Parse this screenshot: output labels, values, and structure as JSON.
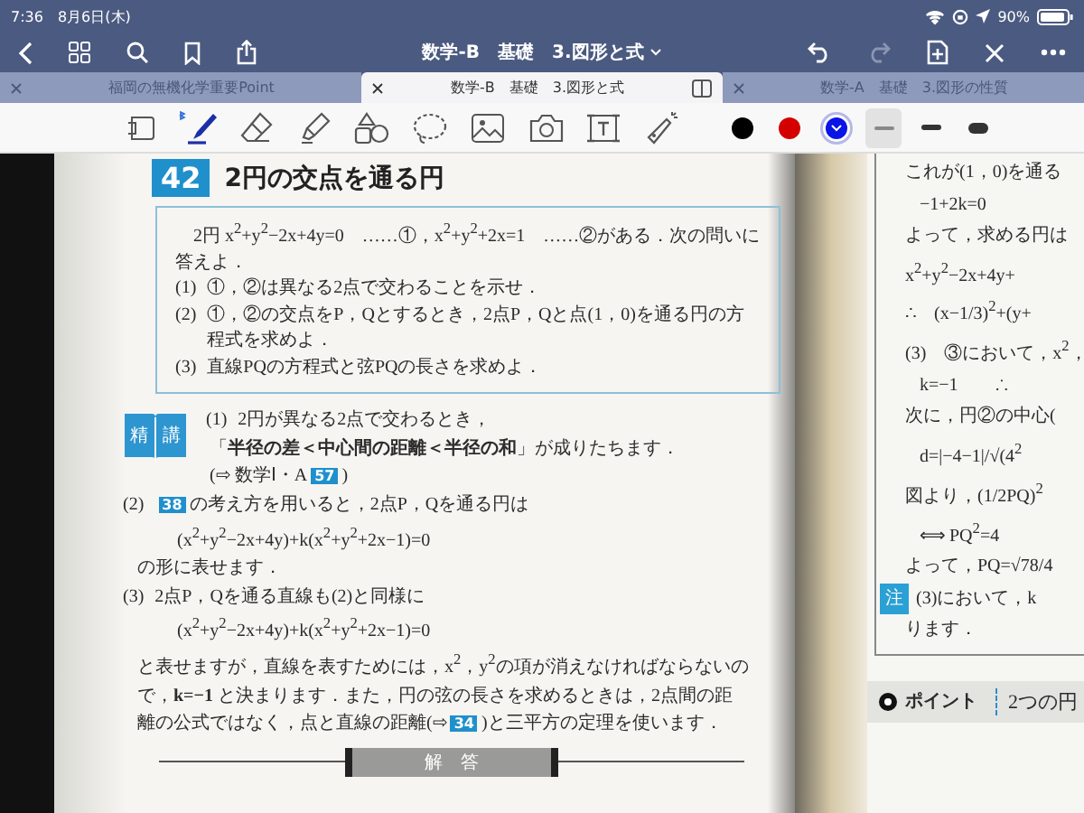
{
  "status_bar": {
    "time": "7:36",
    "date": "8月6日(木)",
    "battery": "90%"
  },
  "nav_bar": {
    "title": "数学-B　基礎　3.図形と式",
    "redo_disabled": true
  },
  "tabs": [
    {
      "label": "福岡の無機化学重要Point",
      "selected": false
    },
    {
      "label": "数学-B　基礎　3.図形と式",
      "selected": true
    },
    {
      "label": "数学-A　基礎　3.図形の性質",
      "selected": false
    }
  ],
  "toolbar": {
    "tools": [
      {
        "kind": "page",
        "selected": false
      },
      {
        "kind": "pen",
        "selected": true
      },
      {
        "kind": "eraser",
        "selected": false
      },
      {
        "kind": "highlighter",
        "selected": false
      },
      {
        "kind": "shapes",
        "selected": false
      },
      {
        "kind": "lasso",
        "selected": false
      },
      {
        "kind": "image",
        "selected": false
      },
      {
        "kind": "camera",
        "selected": false
      },
      {
        "kind": "text",
        "selected": false
      },
      {
        "kind": "laser",
        "selected": false
      }
    ],
    "colors": [
      {
        "color": "#000000",
        "selected": false
      },
      {
        "color": "#d40000",
        "selected": false
      },
      {
        "color": "#0a14e6",
        "selected": true
      }
    ],
    "widths": [
      {
        "kind": "thin",
        "selected": true
      },
      {
        "kind": "medium",
        "selected": false
      },
      {
        "kind": "thick",
        "selected": false
      }
    ]
  },
  "left_page": {
    "number": "42",
    "title": "2円の交点を通る円",
    "problem_intro": "2円 x$^{2}$+y$^{2}$−2x+4y=0　……①，x$^{2}$+y$^{2}$+2x=1　……②がある．次の問いに答えよ．",
    "problems": [
      {
        "label": "(1)",
        "text": "①，②は異なる2点で交わることを示せ．"
      },
      {
        "label": "(2)",
        "text": "①，②の交点をP，Qとするとき，2点P，Qと点(1，0)を通る円の方程式を求めよ．"
      },
      {
        "label": "(3)",
        "text": "直線PQの方程式と弦PQの長さを求めよ．"
      }
    ],
    "seiko": [
      "精",
      "講"
    ],
    "intro": [
      {
        "kind": "item",
        "label": "(1)",
        "parts": [
          {
            "kind": "text",
            "text": "2円が異なる2点で交わるとき，"
          }
        ]
      },
      {
        "kind": "cont",
        "parts": [
          {
            "kind": "text",
            "text": "「**半径の差＜中心間の距離＜半径の和**」が成りたちます．"
          }
        ]
      },
      {
        "kind": "cont",
        "parts": [
          {
            "kind": "text",
            "text": "(⇨ 数学Ⅰ・A"
          },
          {
            "kind": "ref",
            "text": "57"
          },
          {
            "kind": "text",
            "text": ")"
          }
        ]
      }
    ],
    "body": [
      {
        "kind": "item",
        "label": "(2)",
        "parts": [
          {
            "kind": "ref",
            "text": "38"
          },
          {
            "kind": "text",
            "text": "の考え方を用いると，2点P，Qを通る円は"
          }
        ]
      },
      {
        "kind": "formula",
        "parts": [
          {
            "kind": "text",
            "text": "(x$^{2}$+y$^{2}$−2x+4y)+k(x$^{2}$+y$^{2}$+2x−1)=0"
          }
        ]
      },
      {
        "kind": "para",
        "parts": [
          {
            "kind": "text",
            "text": "の形に表せます．"
          }
        ]
      },
      {
        "kind": "item",
        "label": "(3)",
        "parts": [
          {
            "kind": "text",
            "text": "2点P，Qを通る直線も(2)と同様に"
          }
        ]
      },
      {
        "kind": "formula",
        "parts": [
          {
            "kind": "text",
            "text": "(x$^{2}$+y$^{2}$−2x+4y)+k(x$^{2}$+y$^{2}$+2x−1)=0"
          }
        ]
      },
      {
        "kind": "para",
        "parts": [
          {
            "kind": "text",
            "text": "と表せますが，直線を表すためには，x$^{2}$，y$^{2}$の項が消えなければならないの"
          }
        ]
      },
      {
        "kind": "para",
        "parts": [
          {
            "kind": "text",
            "text": "で，**k=−1** と決まります．また，円の弦の長さを求めるときは，2点間の距"
          }
        ]
      },
      {
        "kind": "para",
        "parts": [
          {
            "kind": "text",
            "text": "離の公式ではなく，点と直線の距離(⇨"
          },
          {
            "kind": "ref",
            "text": "34"
          },
          {
            "kind": "text",
            "text": ")と三平方の定理を使います．"
          }
        ]
      }
    ],
    "answer_heading": "解　答"
  },
  "right_page": {
    "lines": [
      {
        "kind": "text",
        "text": "これが(1，0)を通る"
      },
      {
        "kind": "indent",
        "text": "−1+2k=0"
      },
      {
        "kind": "text",
        "text": "よって，求める円は"
      },
      {
        "kind": "text",
        "text": "x$^{2}$+y$^{2}$−2x+4y+"
      },
      {
        "kind": "text",
        "text": "∴　(x−1/3)$^{2}$+(y+"
      },
      {
        "kind": "text",
        "text": "(3)　③において，x$^{2}$，"
      },
      {
        "kind": "indent",
        "text": "k=−1　　∴"
      },
      {
        "kind": "text",
        "text": "次に，円②の中心("
      },
      {
        "kind": "indent",
        "text": "d=|−4−1|/√(4$^{2}$"
      },
      {
        "kind": "text",
        "text": "図より，(1/2PQ)$^{2}$"
      },
      {
        "kind": "indent",
        "text": "⟺ PQ$^{2}$=4"
      },
      {
        "kind": "text",
        "text": "よって，PQ=√78/4"
      },
      {
        "kind": "note",
        "badge": "注",
        "text": "(3)において，k"
      },
      {
        "kind": "text",
        "text": "ります．"
      }
    ],
    "point": {
      "label": "ポイント",
      "text": "2つの円"
    }
  }
}
